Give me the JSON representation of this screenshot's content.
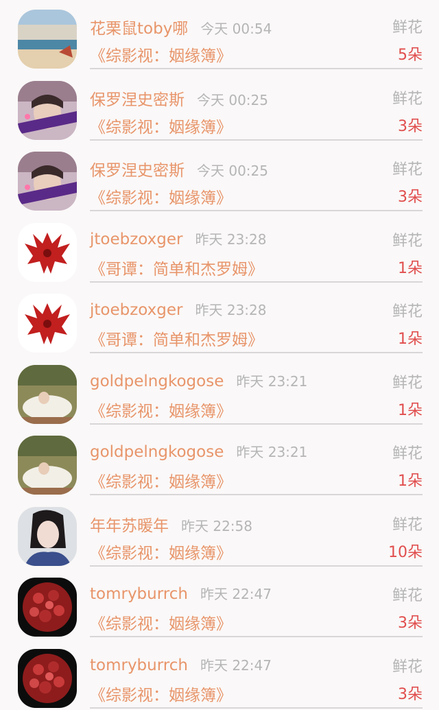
{
  "rows": [
    {
      "name": "花栗鼠toby哪",
      "time": "今天 00:54",
      "kind": "鲜花",
      "book": "《综影视：姻缘簿》",
      "count": "5朵",
      "avatar": "beach"
    },
    {
      "name": "保罗涅史密斯",
      "time": "今天 00:25",
      "kind": "鲜花",
      "book": "《综影视：姻缘簿》",
      "count": "3朵",
      "avatar": "boy"
    },
    {
      "name": "保罗涅史密斯",
      "time": "今天 00:25",
      "kind": "鲜花",
      "book": "《综影视：姻缘簿》",
      "count": "3朵",
      "avatar": "boy"
    },
    {
      "name": "jtoebzoxger",
      "time": "昨天 23:28",
      "kind": "鲜花",
      "book": "《哥谭：简单和杰罗姆》",
      "count": "1朵",
      "avatar": "phoenix"
    },
    {
      "name": "jtoebzoxger",
      "time": "昨天 23:28",
      "kind": "鲜花",
      "book": "《哥谭：简单和杰罗姆》",
      "count": "1朵",
      "avatar": "phoenix"
    },
    {
      "name": "goldpelngkogose",
      "time": "昨天 23:21",
      "kind": "鲜花",
      "book": "《综影视：姻缘簿》",
      "count": "1朵",
      "avatar": "garden"
    },
    {
      "name": "goldpelngkogose",
      "time": "昨天 23:21",
      "kind": "鲜花",
      "book": "《综影视：姻缘簿》",
      "count": "1朵",
      "avatar": "garden"
    },
    {
      "name": "年年苏暖年",
      "time": "昨天 22:58",
      "kind": "鲜花",
      "book": "《综影视：姻缘簿》",
      "count": "10朵",
      "avatar": "lady"
    },
    {
      "name": "tomryburrch",
      "time": "昨天 22:47",
      "kind": "鲜花",
      "book": "《综影视：姻缘簿》",
      "count": "3朵",
      "avatar": "roses"
    },
    {
      "name": "tomryburrch",
      "time": "昨天 22:47",
      "kind": "鲜花",
      "book": "《综影视：姻缘簿》",
      "count": "3朵",
      "avatar": "roses"
    }
  ],
  "colors": {
    "name": "#e8956a",
    "meta": "#b5b5b5",
    "count": "#e14d4d",
    "background": "#faf8f8"
  }
}
